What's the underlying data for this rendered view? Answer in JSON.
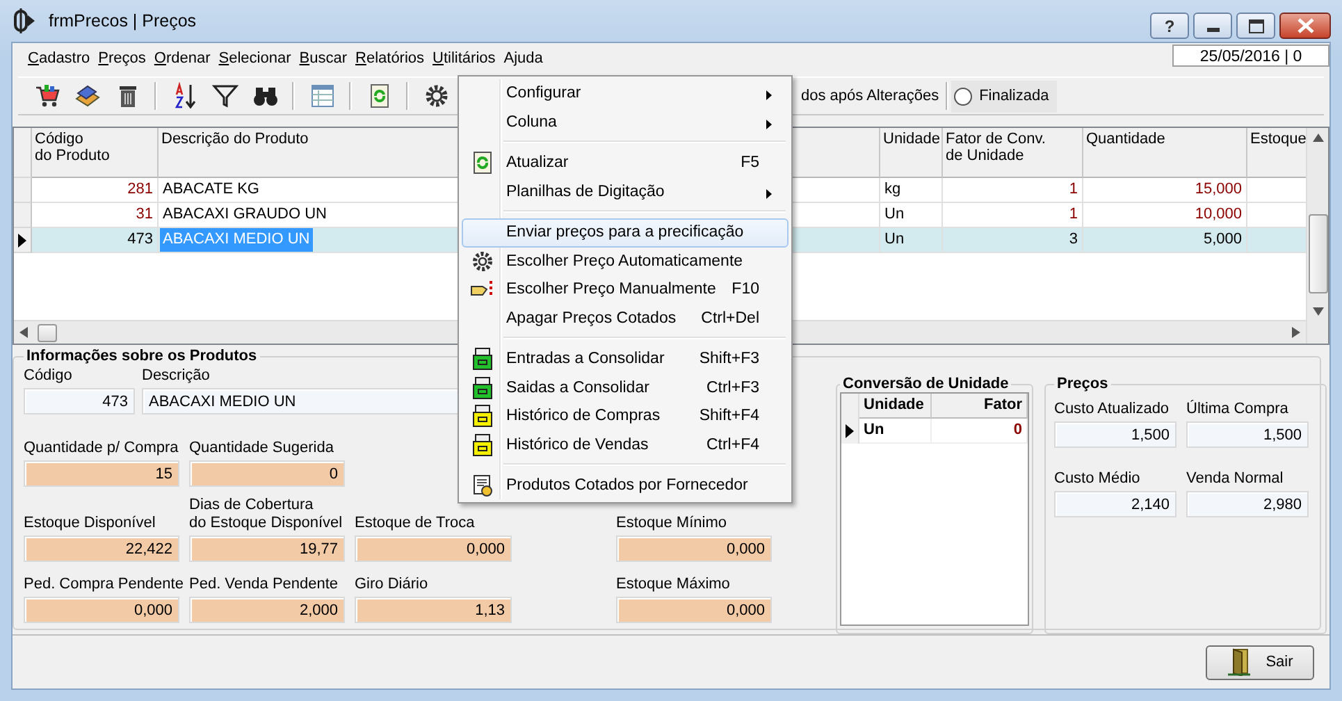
{
  "window": {
    "title": "frmPrecos | Preços",
    "help_button": "?"
  },
  "menu_bar": [
    {
      "label": "Cadastro",
      "mnemonic": true
    },
    {
      "label": "Preços",
      "mnemonic": true
    },
    {
      "label": "Ordenar",
      "mnemonic": true
    },
    {
      "label": "Selecionar",
      "mnemonic": true
    },
    {
      "label": "Buscar",
      "mnemonic": true
    },
    {
      "label": "Relatórios",
      "mnemonic": true
    },
    {
      "label": "Utilitários",
      "mnemonic": true
    },
    {
      "label": "Ajuda",
      "mnemonic": false
    }
  ],
  "date": "25/05/2016 | 0",
  "toolbar": {
    "partial_label": "dos após Alterações",
    "radio": {
      "label": "Finalizada",
      "selected": false
    }
  },
  "grid": {
    "columns": [
      {
        "label": "Código\ndo Produto"
      },
      {
        "label": "Descrição do Produto"
      },
      {
        "label": "Unidade"
      },
      {
        "label": "Fator de Conv.\nde Unidade"
      },
      {
        "label": "Quantidade"
      },
      {
        "label": "Estoque"
      }
    ],
    "rows": [
      {
        "code": "281",
        "description": "ABACATE KG",
        "unit": "kg",
        "factor": "1",
        "quantity": "15,000",
        "alert": true,
        "selected": false
      },
      {
        "code": "31",
        "description": "ABACAXI GRAUDO  UN",
        "unit": "Un",
        "factor": "1",
        "quantity": "10,000",
        "alert": true,
        "selected": false
      },
      {
        "code": "473",
        "description": "ABACAXI MEDIO UN",
        "unit": "Un",
        "factor": "3",
        "quantity": "5,000",
        "alert": false,
        "selected": true
      }
    ]
  },
  "context_menu": {
    "items": [
      {
        "kind": "item",
        "label": "Configurar",
        "submenu": true,
        "selected": false
      },
      {
        "kind": "item",
        "label": "Coluna",
        "submenu": true,
        "selected": false
      },
      {
        "kind": "separator"
      },
      {
        "kind": "item",
        "label": "Atualizar",
        "shortcut": "F5",
        "submenu": false,
        "selected": false
      },
      {
        "kind": "item",
        "label": "Planilhas de Digitação",
        "submenu": true,
        "selected": false
      },
      {
        "kind": "separator"
      },
      {
        "kind": "item",
        "label": "Enviar preços para a precificação",
        "submenu": false,
        "selected": true
      },
      {
        "kind": "item",
        "label": "Escolher Preço Automaticamente",
        "submenu": false,
        "selected": false
      },
      {
        "kind": "item",
        "label": "Escolher Preço Manualmente",
        "shortcut": "F10",
        "submenu": false,
        "selected": false
      },
      {
        "kind": "item",
        "label": "Apagar Preços Cotados",
        "shortcut": "Ctrl+Del",
        "submenu": false,
        "selected": false
      },
      {
        "kind": "separator"
      },
      {
        "kind": "item",
        "label": "Entradas a Consolidar",
        "shortcut": "Shift+F3",
        "submenu": false,
        "selected": false
      },
      {
        "kind": "item",
        "label": "Saidas a Consolidar",
        "shortcut": "Ctrl+F3",
        "submenu": false,
        "selected": false
      },
      {
        "kind": "item",
        "label": "Histórico de Compras",
        "shortcut": "Shift+F4",
        "submenu": false,
        "selected": false
      },
      {
        "kind": "item",
        "label": "Histórico de Vendas",
        "shortcut": "Ctrl+F4",
        "submenu": false,
        "selected": false
      },
      {
        "kind": "separator"
      },
      {
        "kind": "item",
        "label": "Produtos Cotados por Fornecedor",
        "submenu": false,
        "selected": false
      }
    ]
  },
  "product_info": {
    "title": "Informações sobre os Produtos",
    "code": {
      "label": "Código",
      "value": "473"
    },
    "description": {
      "label": "Descrição",
      "value": "ABACAXI MEDIO UN"
    },
    "rows": [
      [
        {
          "label": "Quantidade p/ Compra",
          "value": "15"
        },
        {
          "label": "Quantidade Sugerida",
          "value": "0"
        }
      ],
      [
        {
          "label": "Estoque Disponível",
          "value": "22,422"
        },
        {
          "label": "Dias de Cobertura\ndo Estoque Disponível",
          "value": "19,77"
        },
        {
          "label": "Estoque de Troca",
          "value": "0,000"
        }
      ],
      [
        {
          "label": "Ped. Compra Pendente",
          "value": "0,000"
        },
        {
          "label": "Ped. Venda Pendente",
          "value": "2,000"
        },
        {
          "label": "Giro Diário",
          "value": "1,13"
        }
      ]
    ],
    "side_fields": [
      {
        "label": "Estoque Mínimo",
        "value": "0,000"
      },
      {
        "label": "Estoque Máximo",
        "value": "0,000"
      }
    ]
  },
  "unit_conversion": {
    "title": "Conversão de Unidade",
    "columns": [
      "Unidade",
      "Fator"
    ],
    "rows": [
      {
        "unit": "Un",
        "factor": "0",
        "selected": true
      }
    ]
  },
  "prices": {
    "title": "Preços",
    "fields": [
      {
        "label": "Custo Atualizado",
        "value": "1,500"
      },
      {
        "label": "Última Compra",
        "value": "1,500"
      },
      {
        "label": "Custo Médio",
        "value": "2,140"
      },
      {
        "label": "Venda Normal",
        "value": "2,980"
      }
    ]
  },
  "exit_button": {
    "label": "Sair"
  }
}
